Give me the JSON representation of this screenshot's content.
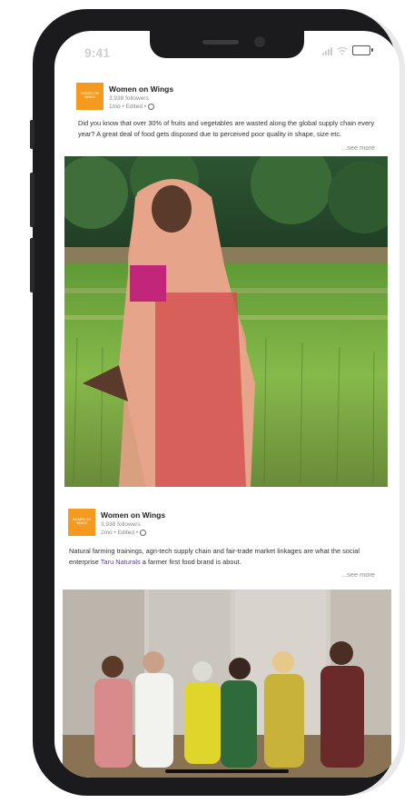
{
  "status_bar": {
    "time": "9:41"
  },
  "posts": [
    {
      "org_name": "Women on Wings",
      "logo_text": "WOMEN ON WINGS",
      "followers": "3,938 followers",
      "time": "1mo • Edited •",
      "text": "Did you know that over 30% of fruits and vegetables are wasted along the global supply chain every year? A great deal of food gets disposed due to perceived poor quality in shape, size etc.",
      "see_more": "...see more"
    },
    {
      "org_name": "Women on Wings",
      "logo_text": "WOMEN ON WINGS",
      "followers": "3,938 followers",
      "time": "2mo • Edited •",
      "text_before": "Natural farming trainings, agri-tech supply chain and fair-trade market linkages are what the social enterprise ",
      "link_text": "Taru Naturals",
      "text_after": " a farmer first food brand is about.",
      "see_more": "...see more"
    }
  ],
  "colors": {
    "brand": "#f39a1f",
    "link": "#5a3fa0"
  }
}
